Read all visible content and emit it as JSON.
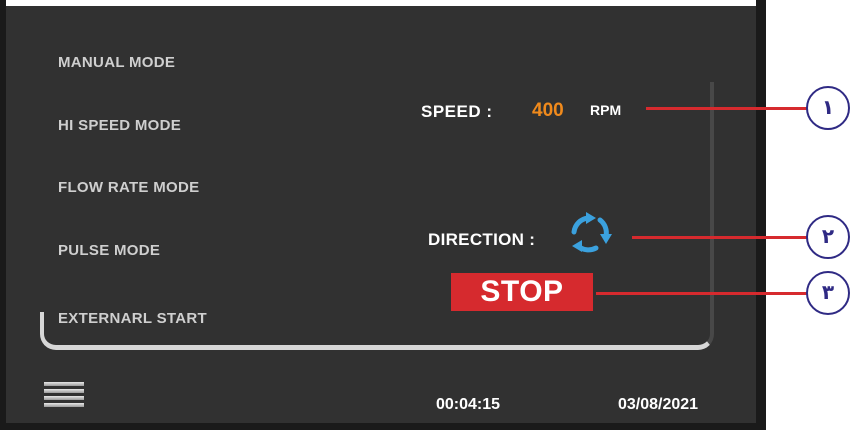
{
  "menu": {
    "items": [
      {
        "label": "MANUAL MODE"
      },
      {
        "label": "HI SPEED MODE"
      },
      {
        "label": "FLOW RATE MODE"
      },
      {
        "label": "PULSE MODE"
      },
      {
        "label": "EXTERNARL START"
      }
    ]
  },
  "status": {
    "speed_label": "SPEED :",
    "speed_value": "400",
    "speed_unit": "RPM",
    "direction_label": "DIRECTION :",
    "direction_icon": "rotation-arrows-icon"
  },
  "controls": {
    "stop_label": "STOP"
  },
  "footer": {
    "time": "00:04:15",
    "date": "03/08/2021",
    "menu_icon": "hamburger-menu-icon"
  },
  "callouts": {
    "c1": "١",
    "c2": "٢",
    "c3": "٣"
  },
  "colors": {
    "background": "#313131",
    "accent_speed": "#f08a1c",
    "stop_button": "#d62a2e",
    "callout_border": "#2f2a84",
    "direction_icon": "#3ba1de"
  }
}
